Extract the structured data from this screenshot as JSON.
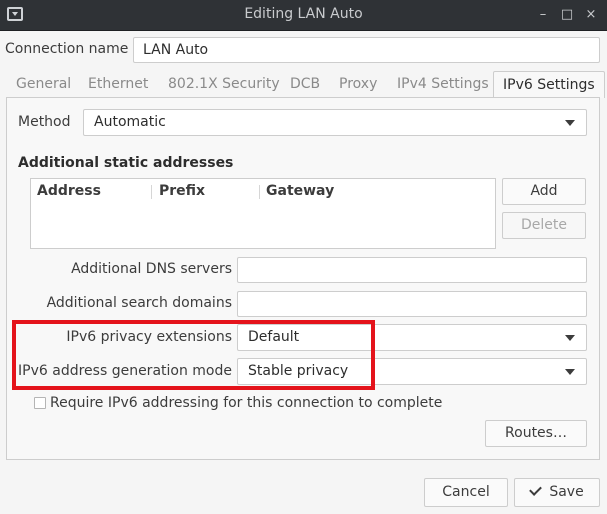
{
  "window": {
    "title": "Editing LAN Auto",
    "controls": {
      "minimize": "–",
      "maximize": "□",
      "close": "×"
    }
  },
  "connection": {
    "label": "Connection name",
    "value": "LAN Auto"
  },
  "tabs": [
    {
      "label": "General"
    },
    {
      "label": "Ethernet"
    },
    {
      "label": "802.1X Security"
    },
    {
      "label": "DCB"
    },
    {
      "label": "Proxy"
    },
    {
      "label": "IPv4 Settings"
    },
    {
      "label": "IPv6 Settings",
      "active": true
    }
  ],
  "method": {
    "label": "Method",
    "value": "Automatic"
  },
  "static_addresses": {
    "title": "Additional static addresses",
    "columns": [
      "Address",
      "Prefix",
      "Gateway"
    ],
    "add_label": "Add",
    "delete_label": "Delete"
  },
  "dns": {
    "label": "Additional DNS servers",
    "value": ""
  },
  "search_domains": {
    "label": "Additional search domains",
    "value": ""
  },
  "privacy": {
    "label": "IPv6 privacy extensions",
    "value": "Default"
  },
  "addr_gen": {
    "label": "IPv6 address generation mode",
    "value": "Stable privacy"
  },
  "require": {
    "label": "Require IPv6 addressing for this connection to complete",
    "checked": false
  },
  "routes_label": "Routes…",
  "footer": {
    "cancel_label": "Cancel",
    "save_label": "Save"
  },
  "colors": {
    "highlight": "#e4131b",
    "titlebar": "#2f3236"
  }
}
